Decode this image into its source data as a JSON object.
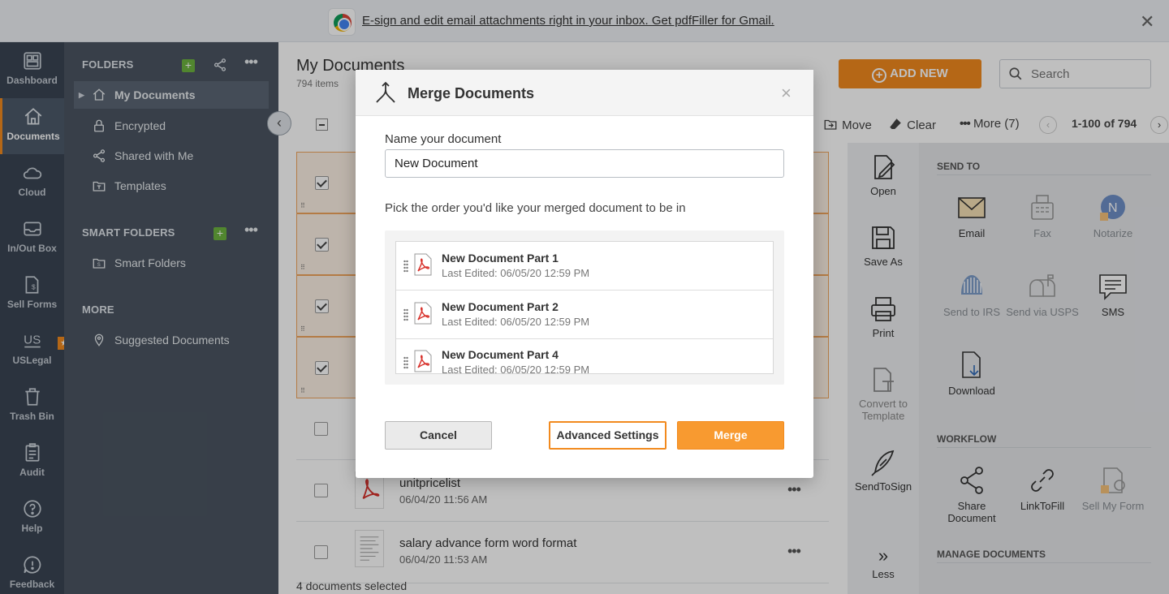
{
  "banner": {
    "text": "E-sign and edit email attachments right in your inbox. Get pdfFiller for Gmail.",
    "icon": "chrome-icon",
    "close_icon": "close-icon"
  },
  "rail": [
    {
      "label": "Dashboard",
      "icon": "dashboard-icon"
    },
    {
      "label": "Documents",
      "icon": "home-icon",
      "active": true
    },
    {
      "label": "Cloud",
      "icon": "cloud-icon"
    },
    {
      "label": "In/Out Box",
      "icon": "inbox-icon"
    },
    {
      "label": "Sell Forms",
      "icon": "sell-forms-icon"
    },
    {
      "label": "USLegal",
      "icon": "uslegal-icon",
      "badge": "★"
    },
    {
      "label": "Trash Bin",
      "icon": "trash-icon"
    },
    {
      "label": "Audit",
      "icon": "audit-icon"
    },
    {
      "label": "Help",
      "icon": "help-icon"
    },
    {
      "label": "Feedback",
      "icon": "feedback-icon"
    }
  ],
  "folders": {
    "title": "FOLDERS",
    "add": "+",
    "more": "•••",
    "items": [
      {
        "label": "My Documents",
        "selected": true
      },
      {
        "label": "Encrypted"
      },
      {
        "label": "Shared with Me"
      },
      {
        "label": "Templates"
      }
    ],
    "smart_title": "SMART FOLDERS",
    "smart_items": [
      {
        "label": "Smart Folders"
      }
    ],
    "more_title": "MORE",
    "more_items": [
      {
        "label": "Suggested Documents"
      }
    ]
  },
  "main": {
    "title": "My Documents",
    "count": "794 items",
    "add_new": "ADD NEW",
    "search_placeholder": "Search",
    "toolbar": {
      "move": "Move",
      "clear": "Clear",
      "more": "More (7)",
      "pagination": "1-100 of 794"
    },
    "docs": [
      {
        "name": "unitpricelist",
        "date": "06/04/20 11:56 AM"
      },
      {
        "name": "salary advance form word format",
        "date": "06/04/20 11:53 AM"
      }
    ],
    "status": "4 documents selected"
  },
  "actions_mid": [
    {
      "label": "Open",
      "icon": "open-icon"
    },
    {
      "label": "Save As",
      "icon": "save-icon"
    },
    {
      "label": "Print",
      "icon": "print-icon"
    },
    {
      "label": "Convert to Template",
      "icon": "convert-template-icon"
    },
    {
      "label": "SendToSign",
      "icon": "quill-icon"
    },
    {
      "label": "Less",
      "icon": "chevrons-right-icon"
    }
  ],
  "actions_right": {
    "send_to_title": "SEND TO",
    "send_to": [
      {
        "label": "Email",
        "icon": "email-icon"
      },
      {
        "label": "Fax",
        "icon": "fax-icon"
      },
      {
        "label": "Notarize",
        "icon": "notarize-icon"
      },
      {
        "label": "Send to IRS",
        "icon": "irs-icon"
      },
      {
        "label": "Send via USPS",
        "icon": "mailbox-icon"
      },
      {
        "label": "SMS",
        "icon": "sms-icon"
      },
      {
        "label": "Download",
        "icon": "download-icon"
      }
    ],
    "workflow_title": "WORKFLOW",
    "workflow": [
      {
        "label": "Share Document",
        "icon": "share-icon"
      },
      {
        "label": "LinkToFill",
        "icon": "link-icon"
      },
      {
        "label": "Sell My Form",
        "icon": "sell-form-icon"
      }
    ],
    "manage_title": "MANAGE DOCUMENTS"
  },
  "modal": {
    "title": "Merge Documents",
    "close": "×",
    "name_label": "Name your document",
    "name_value": "New Document",
    "order_hint": "Pick the order you'd like your merged document to be in",
    "parts": [
      {
        "name": "New Document Part 1",
        "edited": "Last Edited: 06/05/20 12:59 PM"
      },
      {
        "name": "New Document Part 2",
        "edited": "Last Edited: 06/05/20 12:59 PM"
      },
      {
        "name": "New Document Part 4",
        "edited": "Last Edited: 06/05/20 12:59 PM"
      }
    ],
    "cancel": "Cancel",
    "advanced": "Advanced Settings",
    "merge": "Merge"
  },
  "colors": {
    "accent": "#f28a1e",
    "rail_bg": "#3a4553",
    "folders_bg": "#4b5562",
    "green": "#6db33f"
  }
}
